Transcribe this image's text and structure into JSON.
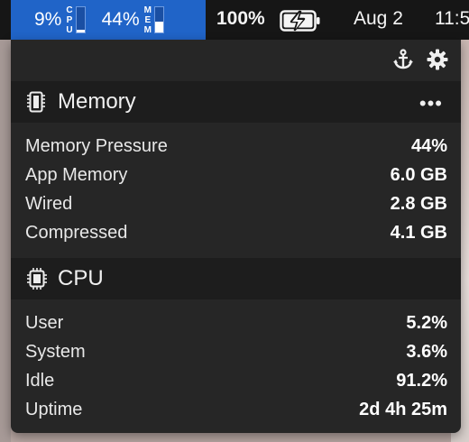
{
  "menubar": {
    "cpu_value": "9%",
    "cpu_label_letters": [
      "C",
      "P",
      "U"
    ],
    "cpu_fill": 0.09,
    "mem_value": "44%",
    "mem_label_letters": [
      "M",
      "E",
      "M"
    ],
    "mem_fill": 0.44,
    "battery_percent": "100%",
    "battery_icon": "battery-charging-icon",
    "date": "Aug 2",
    "time": "11:5",
    "stats_bg": "#2064c8"
  },
  "toolbar": {
    "anchor_icon": "anchor-icon",
    "settings_icon": "gear-icon"
  },
  "memory": {
    "title": "Memory",
    "more": "•••",
    "rows": [
      {
        "label": "Memory Pressure",
        "value": "44%"
      },
      {
        "label": "App Memory",
        "value": "6.0 GB"
      },
      {
        "label": "Wired",
        "value": "2.8 GB"
      },
      {
        "label": "Compressed",
        "value": "4.1 GB"
      }
    ]
  },
  "cpu": {
    "title": "CPU",
    "rows": [
      {
        "label": "User",
        "value": "5.2%"
      },
      {
        "label": "System",
        "value": "3.6%"
      },
      {
        "label": "Idle",
        "value": "91.2%"
      },
      {
        "label": "Uptime",
        "value": "2d 4h 25m"
      }
    ]
  }
}
